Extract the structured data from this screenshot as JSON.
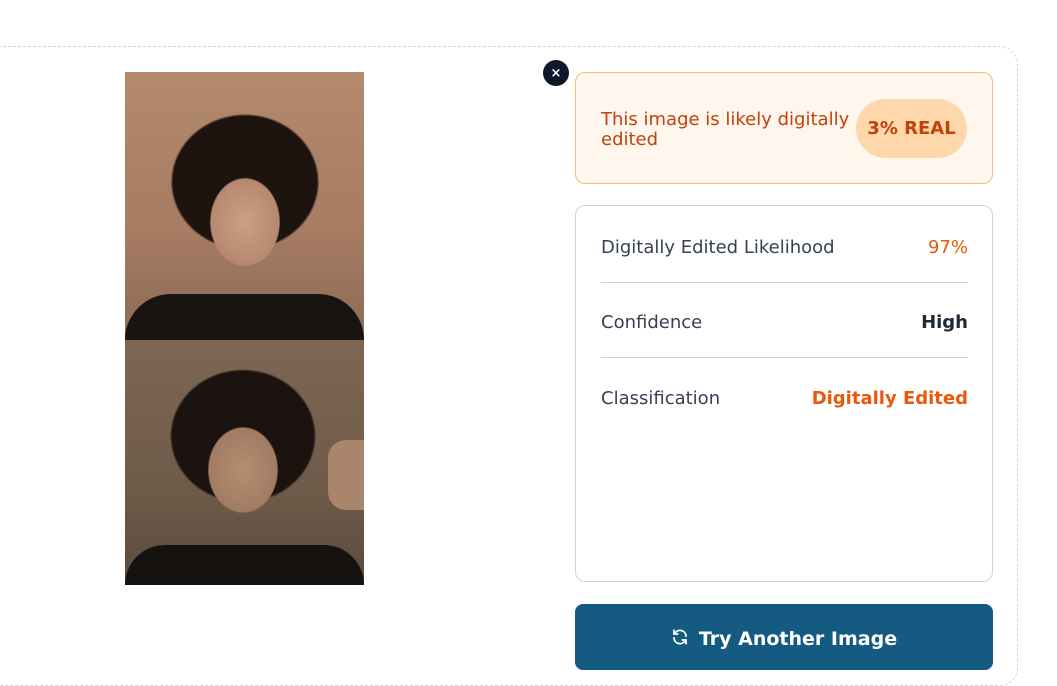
{
  "image": {
    "alt_icon": "portrait-photo"
  },
  "close": {
    "glyph": "×",
    "icon": "close-icon"
  },
  "verdict": {
    "message": "This image is likely digitally edited",
    "badge": "3% REAL",
    "accent_color": "#c2410c",
    "background_color": "#fff7ed"
  },
  "stats": [
    {
      "label": "Digitally Edited Likelihood",
      "value": "97%"
    },
    {
      "label": "Confidence",
      "value": "High"
    },
    {
      "label": "Classification",
      "value": "Digitally Edited"
    }
  ],
  "action": {
    "label": "Try Another Image",
    "icon": "refresh-icon",
    "color": "#155a80"
  }
}
